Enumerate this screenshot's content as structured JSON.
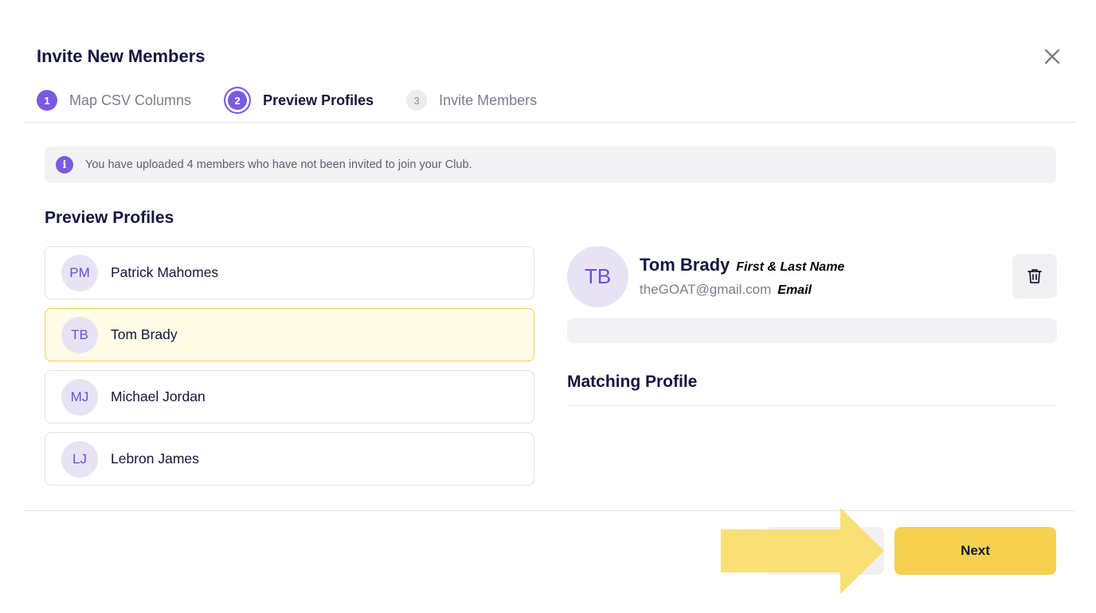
{
  "modal": {
    "title": "Invite New Members",
    "close_icon": "close-icon"
  },
  "steps": [
    {
      "number": "1",
      "label": "Map CSV Columns",
      "state": "done"
    },
    {
      "number": "2",
      "label": "Preview Profiles",
      "state": "active"
    },
    {
      "number": "3",
      "label": "Invite Members",
      "state": "todo"
    }
  ],
  "banner": {
    "icon": "info-icon",
    "icon_glyph": "i",
    "text": "You have uploaded 4 members who have not been invited to join your Club."
  },
  "preview": {
    "title": "Preview Profiles",
    "profiles": [
      {
        "initials": "PM",
        "name": "Patrick Mahomes",
        "selected": false
      },
      {
        "initials": "TB",
        "name": "Tom Brady",
        "selected": true
      },
      {
        "initials": "MJ",
        "name": "Michael Jordan",
        "selected": false
      },
      {
        "initials": "LJ",
        "name": "Lebron James",
        "selected": false
      }
    ]
  },
  "detail": {
    "initials": "TB",
    "name": "Tom Brady",
    "name_annotation": "First & Last Name",
    "email": "theGOAT@gmail.com",
    "email_annotation": "Email",
    "delete_icon": "trash-icon",
    "matching_title": "Matching Profile"
  },
  "footer": {
    "next_label": "Next",
    "arrow_icon": "arrow-right-icon"
  },
  "colors": {
    "accent": "#7a5ae0",
    "selected_bg": "#fffbe6",
    "selected_border": "#f1cc57",
    "next_button": "#f6d150",
    "arrow": "#f8de6e"
  }
}
